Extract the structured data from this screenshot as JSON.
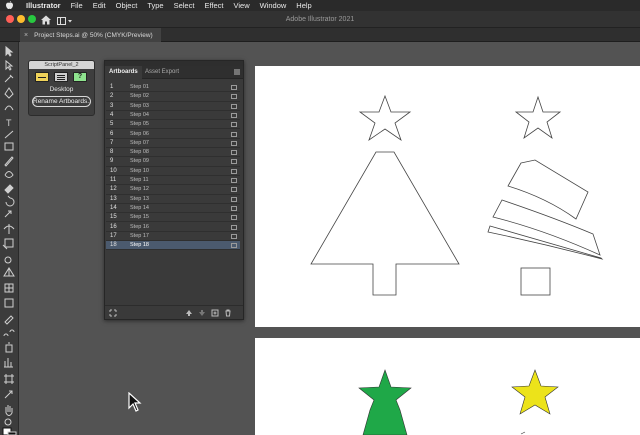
{
  "menubar": {
    "app_name": "Illustrator",
    "items": [
      "File",
      "Edit",
      "Object",
      "Type",
      "Select",
      "Effect",
      "View",
      "Window",
      "Help"
    ]
  },
  "window": {
    "title": "Adobe Illustrator 2021"
  },
  "document_tab": {
    "close_glyph": "×",
    "label": "Project Steps.ai @ 50% (CMYK/Preview)"
  },
  "script_panel": {
    "title": "ScriptPanel_2",
    "help_glyph": "?",
    "label": "Desktop",
    "rename_button": "Rename Artboards..."
  },
  "artboards_panel": {
    "tabs": [
      "Artboards",
      "Asset Export"
    ],
    "rows": [
      {
        "num": "1",
        "name": "Step 01"
      },
      {
        "num": "2",
        "name": "Step 02"
      },
      {
        "num": "3",
        "name": "Step 03"
      },
      {
        "num": "4",
        "name": "Step 04"
      },
      {
        "num": "5",
        "name": "Step 05"
      },
      {
        "num": "6",
        "name": "Step 06"
      },
      {
        "num": "7",
        "name": "Step 07"
      },
      {
        "num": "8",
        "name": "Step 08"
      },
      {
        "num": "9",
        "name": "Step 09"
      },
      {
        "num": "10",
        "name": "Step 10"
      },
      {
        "num": "11",
        "name": "Step 11"
      },
      {
        "num": "12",
        "name": "Step 12"
      },
      {
        "num": "13",
        "name": "Step 13"
      },
      {
        "num": "14",
        "name": "Step 14"
      },
      {
        "num": "15",
        "name": "Step 15"
      },
      {
        "num": "16",
        "name": "Step 16"
      },
      {
        "num": "17",
        "name": "Step 17"
      },
      {
        "num": "18",
        "name": "Step 18"
      }
    ],
    "selected_row": 18
  },
  "colors": {
    "tree_green": "#1fa848",
    "star_yellow": "#ece31a",
    "selection_blue": "#4b5a6e"
  }
}
